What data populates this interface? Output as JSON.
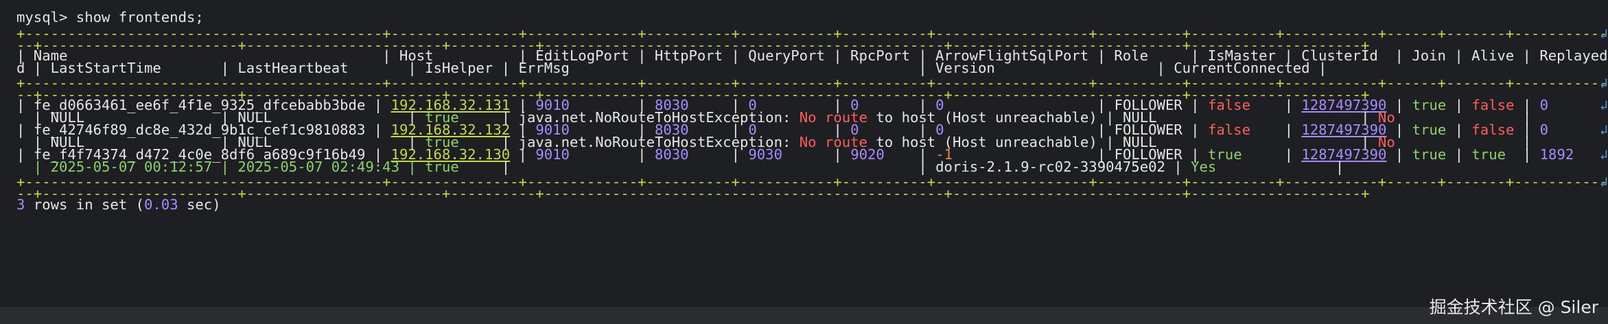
{
  "prompt": "mysql> show frontends;",
  "border_top": "+------------------------------------------+---------------+-------------+----------+-----------+----------+------------------+----------+----------+-----------+------+-------+-------------------",
  "border_top2": "--+-----------------------+-----------------------+----------+-----------------------------------------------+---------------------------+--------------------+",
  "header1": "| Name                                     | Host          | EditLogPort | HttpPort | QueryPort | RpcPort | ArrowFlightSqlPort | Role     | IsMaster | ClusterId  | Join | Alive | ReplayedJournalI",
  "header2": "d | LastStartTime       | LastHeartbeat       | IsHelper | ErrMsg                                         | Version                   | CurrentConnected |",
  "rows": [
    {
      "name": "fe_d0663461_ee6f_4f1e_9325_dfcebabb3bde",
      "host": "192.168.32.131",
      "edit": "9010",
      "http": "8030",
      "query": "0",
      "rpc": "0",
      "arrow": "0",
      "role": "FOLLOWER",
      "master": "false",
      "cluster": "1287497390",
      "join": "true",
      "alive": "false",
      "journal": "0",
      "laststart": "NULL",
      "lastheart": "NULL",
      "helper": "true",
      "err_a": "java.net.NoRouteToHostException: ",
      "err_b": "No route",
      "err_c": " to host (Host unreachable)",
      "version": "NULL",
      "conn": "No"
    },
    {
      "name": "fe_42746f89_dc8e_432d_9b1c_cef1c9810883",
      "host": "192.168.32.132",
      "edit": "9010",
      "http": "8030",
      "query": "0",
      "rpc": "0",
      "arrow": "0",
      "role": "FOLLOWER",
      "master": "false",
      "cluster": "1287497390",
      "join": "true",
      "alive": "false",
      "journal": "0",
      "laststart": "NULL",
      "lastheart": "NULL",
      "helper": "true",
      "err_a": "java.net.NoRouteToHostException: ",
      "err_b": "No route",
      "err_c": " to host (Host unreachable)",
      "version": "NULL",
      "conn": "No"
    },
    {
      "name": "fe_f4f74374_d472_4c0e_8df6_a689c9f16b49",
      "host": "192.168.32.130",
      "edit": "9010",
      "http": "8030",
      "query": "9030",
      "rpc": "9020",
      "arrow": "-1",
      "role": "FOLLOWER",
      "master": "true",
      "cluster": "1287497390",
      "join": "true",
      "alive": "true",
      "journal": "1892",
      "laststart": "2025-05-07 00:12:57",
      "lastheart": "2025-05-07 02:49:43",
      "helper": "true",
      "version": "doris-2.1.9-rc02-3390475e02",
      "conn": "Yes"
    }
  ],
  "summary_prefix": "3",
  "summary_mid": " rows in set (",
  "summary_time": "0.03",
  "summary_end": " sec)",
  "watermark": "掘金技术社区 @ Siler",
  "wrap_hint": "↲"
}
